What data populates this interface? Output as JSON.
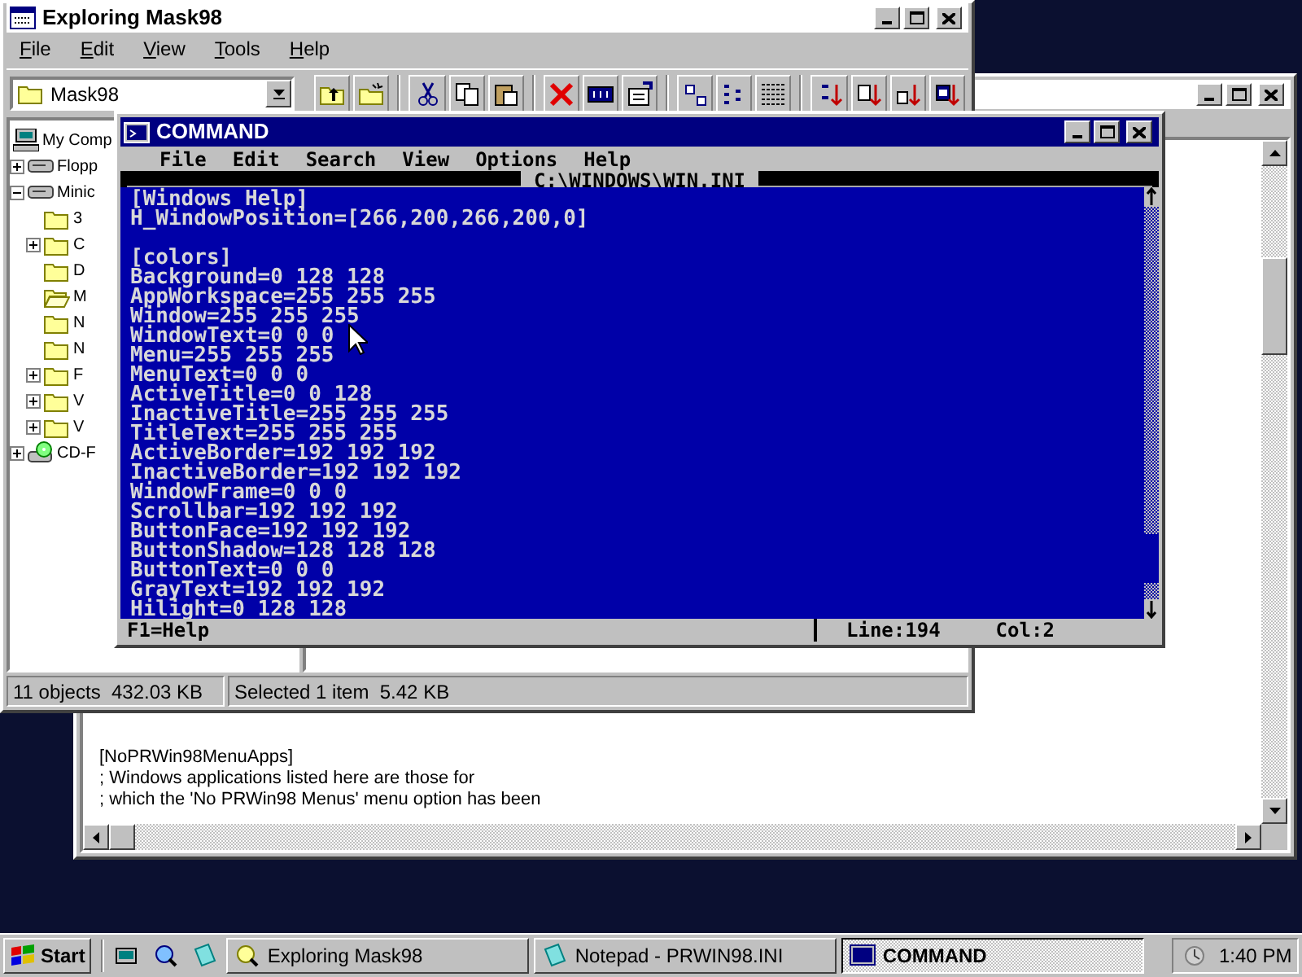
{
  "notepad": {
    "active": false,
    "lines": [
      "[NoPRWin98MenuApps]",
      "; Windows applications listed here are those for",
      "; which the 'No PRWin98 Menus' menu option has been"
    ]
  },
  "explorer": {
    "title": "Exploring Mask98",
    "active": false,
    "menu": [
      "File",
      "Edit",
      "View",
      "Tools",
      "Help"
    ],
    "address": "Mask98",
    "tree": [
      {
        "label": "My Comp",
        "kind": "computer",
        "expandable": false,
        "children": [
          {
            "label": "Flopp",
            "kind": "floppy",
            "expandable": true,
            "expanded": false
          },
          {
            "label": "Minic",
            "kind": "drive",
            "expandable": true,
            "expanded": true,
            "children": [
              {
                "label": "3",
                "kind": "folder",
                "expandable": false
              },
              {
                "label": "C",
                "kind": "folder",
                "expandable": true,
                "expanded": false
              },
              {
                "label": "D",
                "kind": "folder",
                "expandable": false
              },
              {
                "label": "M",
                "kind": "open-folder",
                "expandable": false
              },
              {
                "label": "N",
                "kind": "folder",
                "expandable": false
              },
              {
                "label": "N",
                "kind": "folder",
                "expandable": false
              },
              {
                "label": "F",
                "kind": "folder",
                "expandable": true,
                "expanded": false
              },
              {
                "label": "V",
                "kind": "folder",
                "expandable": true,
                "expanded": false
              },
              {
                "label": "V",
                "kind": "folder",
                "expandable": true,
                "expanded": false
              }
            ]
          },
          {
            "label": "CD-F",
            "kind": "cd",
            "expandable": true,
            "expanded": false
          }
        ]
      }
    ],
    "status": [
      "11 objects  432.03 KB",
      "Selected 1 item  5.42 KB"
    ]
  },
  "command": {
    "title": "COMMAND",
    "active": true,
    "menu": [
      "File",
      "Edit",
      "Search",
      "View",
      "Options",
      "Help"
    ],
    "file_title": "C:\\WINDOWS\\WIN.INI",
    "sections": [
      {
        "lines": [
          "[Windows Help]",
          "H_WindowPosition=[266,200,266,200,0]"
        ]
      },
      {
        "lines": [
          "[colors]",
          "Background=0 128 128",
          "AppWorkspace=255 255 255",
          "Window=255 255 255",
          "WindowText=0 0 0",
          "Menu=255 255 255",
          "MenuText=0 0 0",
          "ActiveTitle=0 0 128",
          "InactiveTitle=255 255 255",
          "TitleText=255 255 255",
          "ActiveBorder=192 192 192",
          "InactiveBorder=192 192 192",
          "WindowFrame=0 0 0",
          "Scrollbar=192 192 192",
          "ButtonFace=192 192 192",
          "ButtonShadow=128 128 128",
          "ButtonText=0 0 0",
          "GrayText=192 192 192",
          "Hilight=0 128 128"
        ]
      }
    ],
    "status": {
      "help": "F1=Help",
      "line": "Line:194",
      "col": "Col:2"
    }
  },
  "taskbar": {
    "start": "Start",
    "tasks": [
      {
        "label": "Exploring Mask98",
        "selected": false
      },
      {
        "label": "Notepad - PRWIN98.INI",
        "selected": false
      },
      {
        "label": "COMMAND",
        "selected": true
      }
    ],
    "clock": "1:40 PM"
  }
}
